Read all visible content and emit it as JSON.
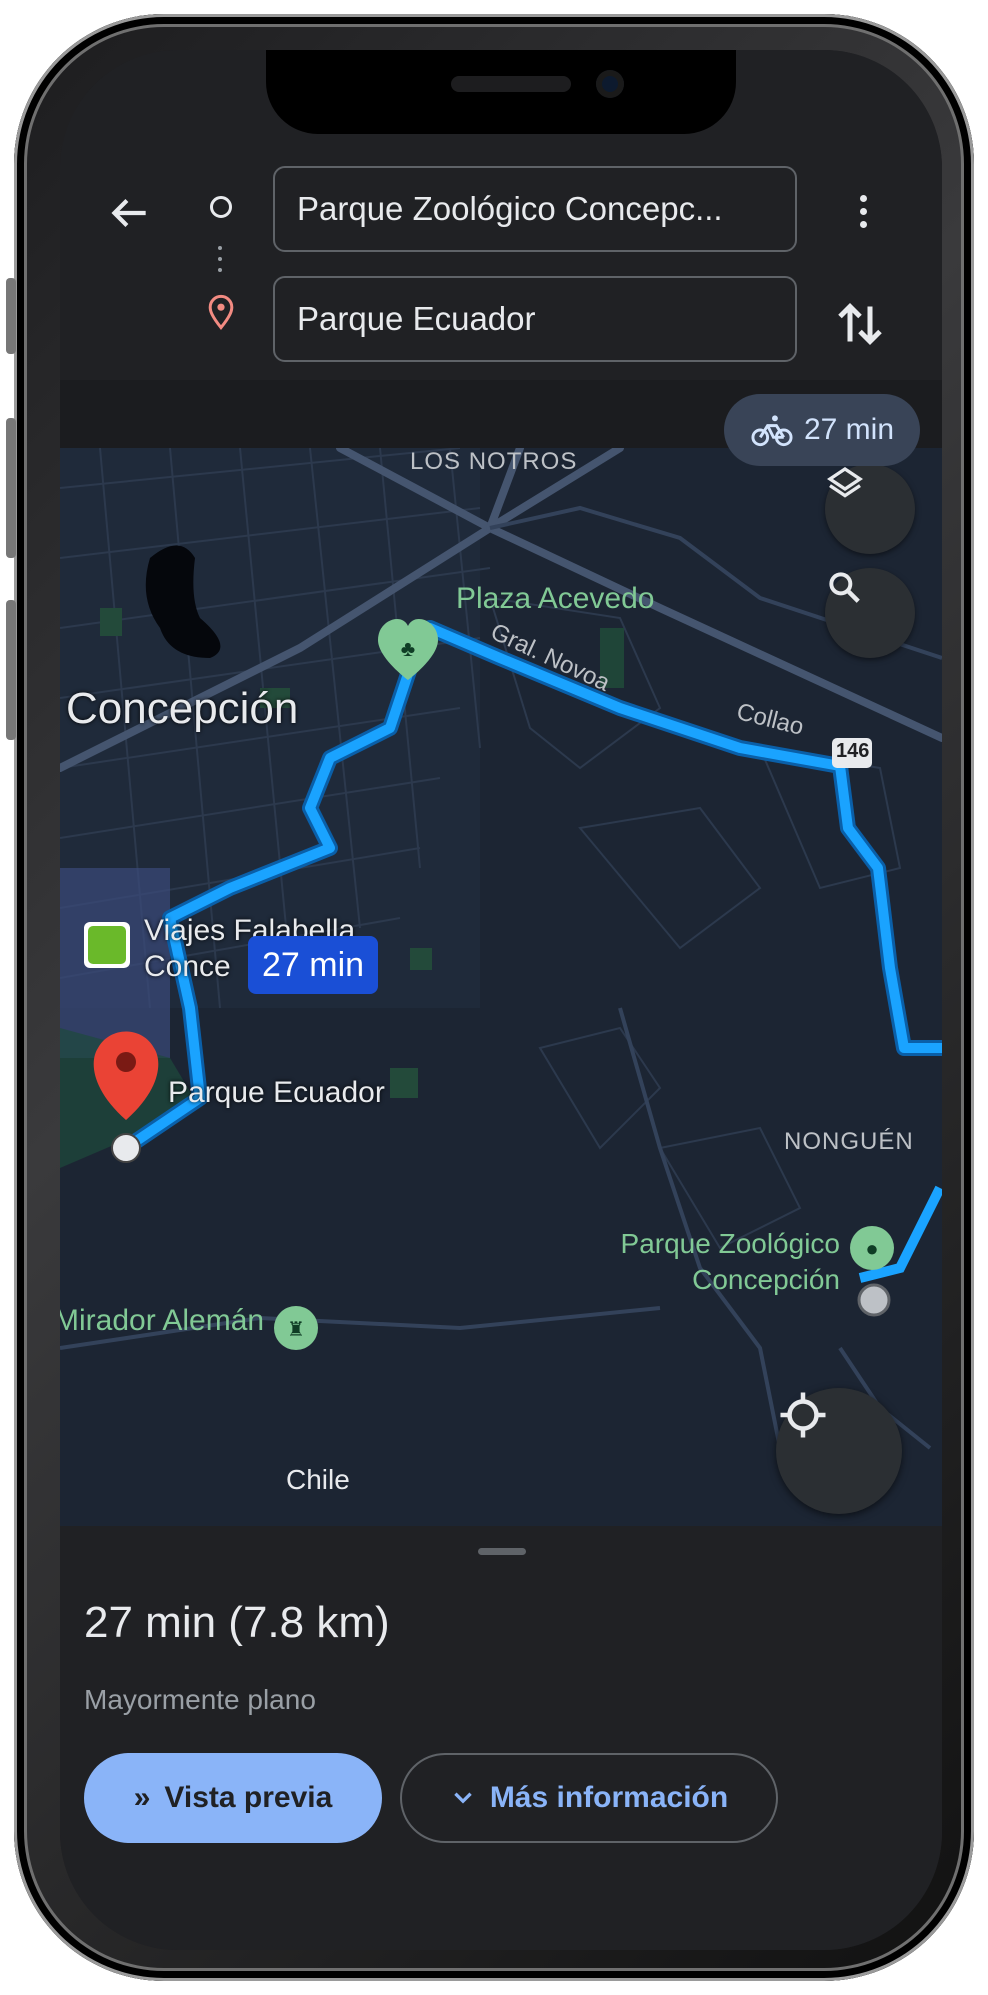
{
  "header": {
    "origin_value": "Parque Zoológico Concepc...",
    "destination_value": "Parque Ecuador"
  },
  "travel_mode": {
    "icon": "bicycle-icon",
    "label": "27 min"
  },
  "map": {
    "places": {
      "los_notros": "LOS NOTROS",
      "plaza_acevedo": "Plaza Acevedo",
      "gral_novoa": "Gral. Novoa",
      "collao": "Collao",
      "route_146": "146",
      "concepcion": "Concepción",
      "viajes_line1": "Viajes Falabella",
      "viajes_line2": "Conce",
      "parque_ecuador": "Parque Ecuador",
      "nonguen": "NONGUÉN",
      "zoo_line1": "Parque Zoológico",
      "zoo_line2": "Concepción",
      "mirador": "Mirador Alemán",
      "chile": "Chile"
    },
    "route_time_pill": "27 min",
    "colors": {
      "route": "#1aa3ff",
      "background": "#1c2533",
      "poi_green": "#81c995"
    }
  },
  "sheet": {
    "duration": "27 min (7.8 km)",
    "subtitle": "Mayormente plano",
    "preview_button": "Vista previa",
    "more_info_button": "Más información"
  }
}
